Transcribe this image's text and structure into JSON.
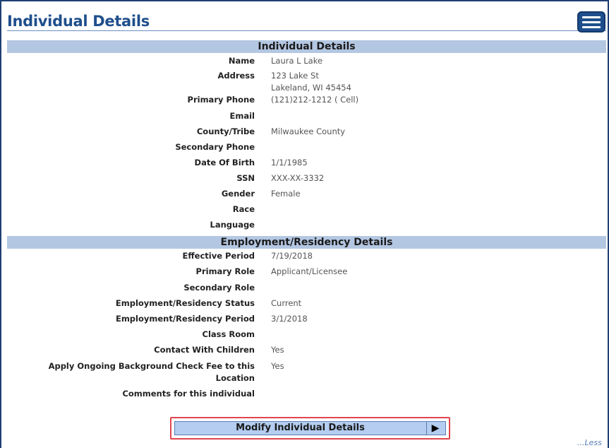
{
  "header": {
    "title": "Individual Details"
  },
  "individual_section": {
    "heading": "Individual Details",
    "fields": {
      "name": {
        "label": "Name",
        "value": "Laura L Lake"
      },
      "address": {
        "label": "Address",
        "value_line1": "123 Lake St",
        "value_line2": "Lakeland, WI 45454"
      },
      "primary_phone": {
        "label": "Primary Phone",
        "value": "(121)212-1212 ( Cell)"
      },
      "email": {
        "label": "Email",
        "value": ""
      },
      "county_tribe": {
        "label": "County/Tribe",
        "value": "Milwaukee County"
      },
      "secondary_phone": {
        "label": "Secondary Phone",
        "value": ""
      },
      "date_of_birth": {
        "label": "Date Of Birth",
        "value": "1/1/1985"
      },
      "ssn": {
        "label": "SSN",
        "value": "XXX-XX-3332"
      },
      "gender": {
        "label": "Gender",
        "value": "Female"
      },
      "race": {
        "label": "Race",
        "value": ""
      },
      "language": {
        "label": "Language",
        "value": ""
      }
    }
  },
  "employment_section": {
    "heading": "Employment/Residency Details",
    "fields": {
      "effective_period": {
        "label": "Effective Period",
        "value": "7/19/2018"
      },
      "primary_role": {
        "label": "Primary Role",
        "value": "Applicant/Licensee"
      },
      "secondary_role": {
        "label": "Secondary Role",
        "value": ""
      },
      "status": {
        "label": "Employment/Residency Status",
        "value": "Current"
      },
      "period": {
        "label": "Employment/Residency Period",
        "value": "3/1/2018"
      },
      "class_room": {
        "label": "Class Room",
        "value": ""
      },
      "contact_children": {
        "label": "Contact With Children",
        "value": "Yes"
      },
      "background_fee": {
        "label_line1": "Apply Ongoing Background Check Fee to this",
        "label_line2": "Location",
        "value": "Yes"
      },
      "comments": {
        "label": "Comments for this individual",
        "value": ""
      }
    }
  },
  "actions": {
    "modify_label": "Modify Individual Details",
    "arrow_glyph": "▶",
    "less_label": "...Less"
  },
  "icons": {
    "menu": "hamburger-menu-icon",
    "arrow": "play-arrow-icon"
  },
  "colors": {
    "title": "#1f4e8c",
    "section_bar": "#b4c7e2",
    "button_bg": "#b4cdf0",
    "highlight_border": "#e0454f"
  }
}
